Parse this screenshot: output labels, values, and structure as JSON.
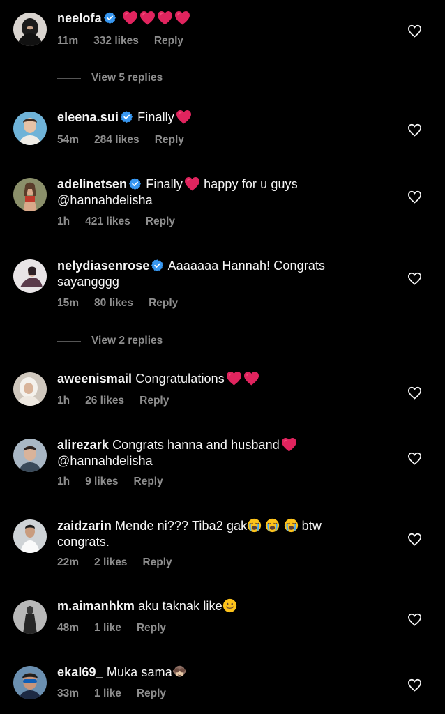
{
  "colors": {
    "background": "#000000",
    "text": "#f5f5f5",
    "muted": "#8e8e8e",
    "verified": "#3897f0",
    "heart": "#e0245e"
  },
  "comments": [
    {
      "username": "neelofa",
      "verified": true,
      "text": "",
      "emoji": [
        "heart",
        "heart",
        "heart",
        "heart"
      ],
      "time": "11m",
      "likes": "332 likes",
      "reply": "Reply",
      "view_replies": "View 5 replies"
    },
    {
      "username": "eleena.sui",
      "verified": true,
      "text": "Finally",
      "emoji": [
        "heart"
      ],
      "time": "54m",
      "likes": "284 likes",
      "reply": "Reply"
    },
    {
      "username": "adelinetsen",
      "verified": true,
      "text": "Finally",
      "text2": "happy for u guys",
      "line2": "@hannahdelisha",
      "emoji": [
        "heart"
      ],
      "time": "1h",
      "likes": "421 likes",
      "reply": "Reply"
    },
    {
      "username": "nelydiasenrose",
      "verified": true,
      "text": "Aaaaaaa Hannah! Congrats",
      "line2": "sayangggg",
      "time": "15m",
      "likes": "80 likes",
      "reply": "Reply",
      "view_replies": "View 2 replies"
    },
    {
      "username": "aweenismail",
      "verified": false,
      "text": "Congratulations",
      "emoji": [
        "heart",
        "heart"
      ],
      "time": "1h",
      "likes": "26 likes",
      "reply": "Reply"
    },
    {
      "username": "alirezark",
      "verified": false,
      "text": "Congrats hanna and husband",
      "emoji": [
        "heart"
      ],
      "line2": "@hannahdelisha",
      "time": "1h",
      "likes": "9 likes",
      "reply": "Reply"
    },
    {
      "username": "zaidzarin",
      "verified": false,
      "text": "Mende ni??? Tiba2 gak",
      "emoji": [
        "loudly-crying-face",
        "loudly-crying-face",
        "loudly-crying-face"
      ],
      "text2": "btw",
      "line2": "congrats.",
      "time": "22m",
      "likes": "2 likes",
      "reply": "Reply"
    },
    {
      "username": "m.aimanhkm",
      "verified": false,
      "text": "aku taknak like",
      "emoji": [
        "smiling-face"
      ],
      "time": "48m",
      "likes": "1 like",
      "reply": "Reply"
    },
    {
      "username": "ekal69_",
      "verified": false,
      "text": "Muka sama",
      "emoji": [
        "see-no-evil-monkey"
      ],
      "time": "33m",
      "likes": "1 like",
      "reply": "Reply"
    }
  ]
}
